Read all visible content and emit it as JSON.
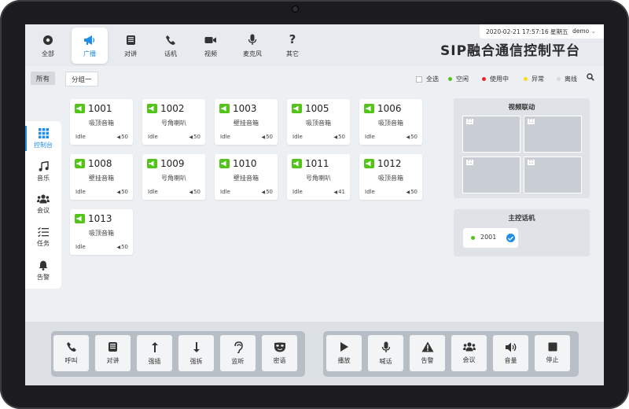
{
  "app": {
    "title": "SIP融合通信控制平台",
    "datetime": "2020-02-21 17:57:16 星期五",
    "user": "demo"
  },
  "nav": [
    {
      "label": "全部",
      "icon": "record-icon"
    },
    {
      "label": "广播",
      "icon": "megaphone-icon",
      "active": true
    },
    {
      "label": "对讲",
      "icon": "intercom-icon"
    },
    {
      "label": "话机",
      "icon": "phone-icon"
    },
    {
      "label": "视频",
      "icon": "video-icon"
    },
    {
      "label": "麦克风",
      "icon": "microphone-icon"
    },
    {
      "label": "其它",
      "icon": "question-icon"
    }
  ],
  "groups": {
    "all": "所有",
    "group1": "分组一"
  },
  "legend": {
    "select_all": "全选",
    "idle": "空闲",
    "idle_color": "#52c41a",
    "busy": "使用中",
    "busy_color": "#f5222d",
    "error": "异常",
    "error_color": "#fadb14",
    "offline": "离线",
    "offline_color": "#d9d9d9"
  },
  "sidebar": [
    {
      "label": "控制台",
      "icon": "grid-icon",
      "active": true
    },
    {
      "label": "音乐",
      "icon": "music-icon"
    },
    {
      "label": "会议",
      "icon": "people-icon"
    },
    {
      "label": "任务",
      "icon": "task-list-icon"
    },
    {
      "label": "告警",
      "icon": "bell-icon"
    }
  ],
  "devices": [
    {
      "id": "1001",
      "type": "吸顶音箱",
      "status": "Idle",
      "volume": "50"
    },
    {
      "id": "1002",
      "type": "号角喇叭",
      "status": "Idle",
      "volume": "50"
    },
    {
      "id": "1003",
      "type": "壁挂音箱",
      "status": "Idle",
      "volume": "50"
    },
    {
      "id": "1005",
      "type": "吸顶音箱",
      "status": "Idle",
      "volume": "50"
    },
    {
      "id": "1006",
      "type": "吸顶音箱",
      "status": "Idle",
      "volume": "50"
    },
    {
      "id": "1008",
      "type": "壁挂音箱",
      "status": "Idle",
      "volume": "50"
    },
    {
      "id": "1009",
      "type": "号角喇叭",
      "status": "Idle",
      "volume": "50"
    },
    {
      "id": "1010",
      "type": "壁挂音箱",
      "status": "Idle",
      "volume": "50"
    },
    {
      "id": "1011",
      "type": "号角喇叭",
      "status": "Idle",
      "volume": "41"
    },
    {
      "id": "1012",
      "type": "吸顶音箱",
      "status": "Idle",
      "volume": "50"
    },
    {
      "id": "1013",
      "type": "吸顶音箱",
      "status": "Idle",
      "volume": "50"
    }
  ],
  "video_panel": {
    "title": "视频联动"
  },
  "master_panel": {
    "title": "主控话机",
    "phone": "2001"
  },
  "toolbar_left": [
    {
      "label": "呼叫",
      "icon": "phone-icon"
    },
    {
      "label": "对讲",
      "icon": "intercom-icon"
    },
    {
      "label": "强插",
      "icon": "arrow-up-icon"
    },
    {
      "label": "强拆",
      "icon": "arrow-down-icon"
    },
    {
      "label": "监听",
      "icon": "ear-icon"
    },
    {
      "label": "密语",
      "icon": "mask-icon"
    }
  ],
  "toolbar_right": [
    {
      "label": "播放",
      "icon": "play-icon"
    },
    {
      "label": "喊话",
      "icon": "microphone-icon"
    },
    {
      "label": "告警",
      "icon": "warning-icon"
    },
    {
      "label": "会议",
      "icon": "people-icon"
    },
    {
      "label": "音量",
      "icon": "volume-icon"
    },
    {
      "label": "停止",
      "icon": "stop-icon"
    }
  ]
}
